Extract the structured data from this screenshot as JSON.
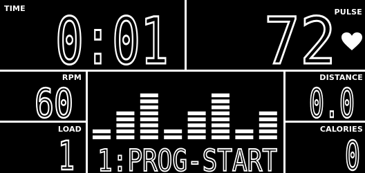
{
  "time": {
    "label": "TIME",
    "value": "0:01"
  },
  "pulse": {
    "label": "PULSE",
    "value": "72",
    "icon": "heart-icon"
  },
  "rpm": {
    "label": "RPM",
    "value": "60"
  },
  "load": {
    "label": "LOAD",
    "value": "1"
  },
  "distance": {
    "label": "DISTANCE",
    "value": "0.0"
  },
  "calories": {
    "label": "CALORIES",
    "value": "0"
  },
  "program": {
    "message": "1:PROG-START",
    "profile_levels": [
      2,
      5,
      8,
      2,
      5,
      8,
      2,
      5
    ]
  }
}
